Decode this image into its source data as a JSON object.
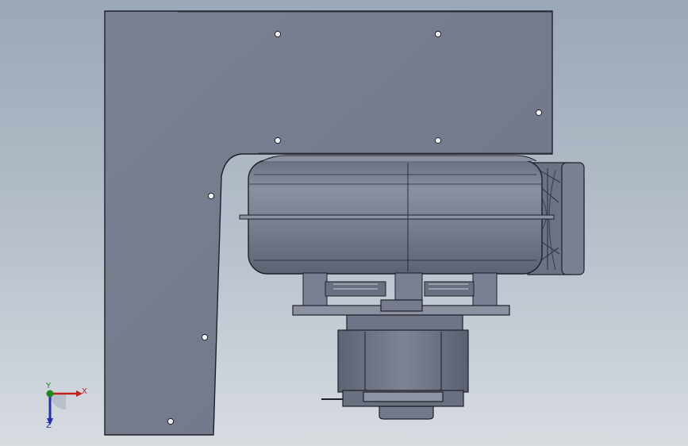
{
  "viewport": {
    "background_top": "#9aa7b7",
    "background_bottom": "#d7dce1"
  },
  "model": {
    "body_color": "#7d8494",
    "edge_color": "#1e2028",
    "hole_color": "#f4f4f6",
    "parts": [
      "bracket-plate",
      "centrifugal-blower-housing",
      "blower-outlet",
      "motor-mount-plate",
      "motor"
    ]
  },
  "triad": {
    "x_label": "X",
    "y_label": "Y",
    "z_label": "Z",
    "x_color": "#c02020",
    "y_color": "#1a8a1a",
    "z_color": "#2030b0"
  }
}
